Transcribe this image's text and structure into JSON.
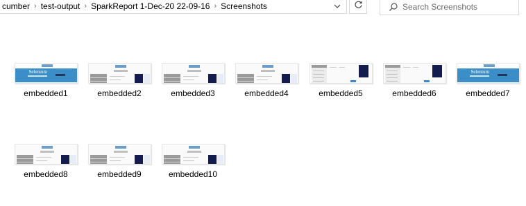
{
  "address_bar": {
    "crumbs": [
      "cumber",
      "test-output",
      "SparkReport 1-Dec-20 22-09-16",
      "Screenshots"
    ]
  },
  "search": {
    "placeholder": "Search Screenshots"
  },
  "icons": {
    "chevron": "chevron-right-icon",
    "dropdown": "chevron-down-icon",
    "refresh": "refresh-icon",
    "search": "search-icon"
  },
  "files": [
    {
      "name": "embedded1",
      "thumb": "blue"
    },
    {
      "name": "embedded2",
      "thumb": "form"
    },
    {
      "name": "embedded3",
      "thumb": "form"
    },
    {
      "name": "embedded4",
      "thumb": "form"
    },
    {
      "name": "embedded5",
      "thumb": "side"
    },
    {
      "name": "embedded6",
      "thumb": "side"
    },
    {
      "name": "embedded7",
      "thumb": "blue"
    },
    {
      "name": "embedded8",
      "thumb": "form"
    },
    {
      "name": "embedded9",
      "thumb": "form"
    },
    {
      "name": "embedded10",
      "thumb": "form"
    }
  ],
  "thumb_text": {
    "blue": "Selenium"
  },
  "colors": {
    "accent_blue": "#3b8ec8",
    "panel_navy": "#141b4d"
  }
}
